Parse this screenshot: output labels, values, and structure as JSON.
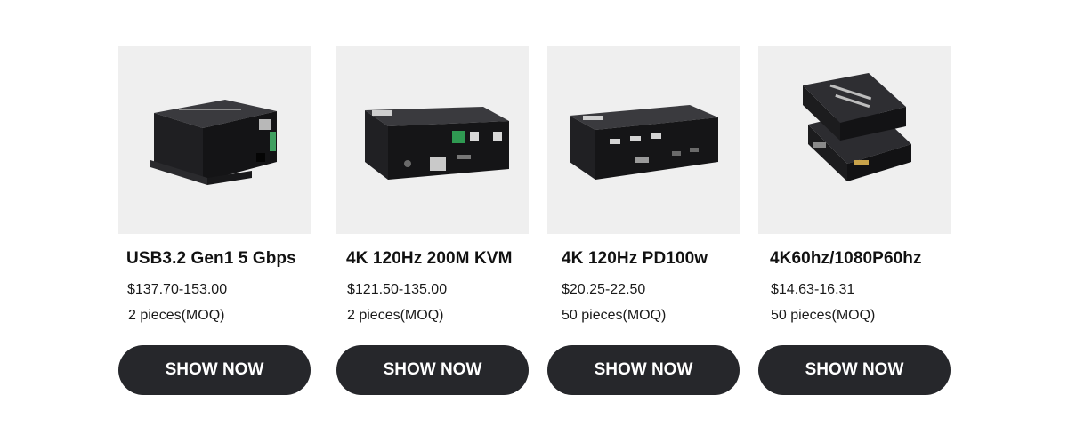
{
  "products": [
    {
      "title": "USB3.2 Gen1 5 Gbps",
      "price": "$137.70-153.00",
      "moq": "2 pieces(MOQ)",
      "button_label": "SHOW NOW",
      "image_icon": "usb-extender-box-icon"
    },
    {
      "title": "4K 120Hz 200M KVM",
      "price": "$121.50-135.00",
      "moq": "2 pieces(MOQ)",
      "button_label": "SHOW NOW",
      "image_icon": "kvm-ip-extender-icon"
    },
    {
      "title": "4K 120Hz PD100w",
      "price": "$20.25-22.50",
      "moq": "50 pieces(MOQ)",
      "button_label": "SHOW NOW",
      "image_icon": "typec-kvm-switch-icon"
    },
    {
      "title": "4K60hz/1080P60hz",
      "price": "$14.63-16.31",
      "moq": "50 pieces(MOQ)",
      "button_label": "SHOW NOW",
      "image_icon": "hdmi-splitter-icon"
    }
  ],
  "colors": {
    "button_bg": "#26272b",
    "image_bg": "#efefef",
    "device_body": "#1c1c1e"
  }
}
